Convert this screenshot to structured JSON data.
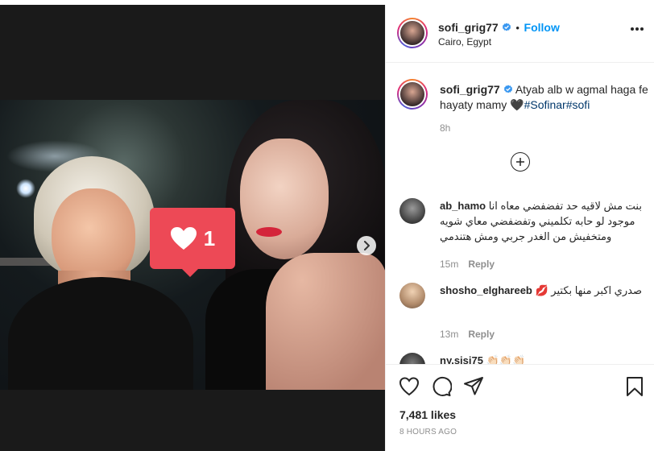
{
  "post": {
    "username": "sofi_grig77",
    "location": "Cairo, Egypt",
    "follow_label": "Follow",
    "dot": "•",
    "like_overlay_count": "1",
    "caption": {
      "username": "sofi_grig77",
      "text": "Atyab alb w agmal haga fe hayaty mamy",
      "heart": "🖤",
      "hashtags": [
        "#Sofinar",
        "#sofi"
      ],
      "time": "8h"
    },
    "comments": [
      {
        "username": "ab_hamo",
        "text": "بنت مش لاقيه حد تفضفضي معاه انا موجود لو حابه تكلميني وتفضفضي معاي شويه ومتخفيش من الغدر جربي ومش هتندمي",
        "time": "15m",
        "reply_label": "Reply"
      },
      {
        "username": "shosho_elghareeb",
        "text": "صدري اكبر منها بكتير 💋",
        "time": "13m",
        "reply_label": "Reply"
      },
      {
        "username": "ny.sisi75",
        "text": "👏🏻👏🏻👏🏻",
        "time": "",
        "reply_label": ""
      }
    ],
    "likes_text": "7,481 likes",
    "posted_ago": "8 HOURS AGO"
  },
  "colors": {
    "accent": "#0095f6",
    "like_red": "#ed4956",
    "hashtag": "#00376b",
    "muted": "#8e8e8e"
  },
  "icons": {
    "more": "more-options-icon",
    "verified": "verified-badge-icon",
    "like": "heart-icon",
    "comment": "comment-icon",
    "share": "share-icon",
    "save": "bookmark-icon",
    "load_more": "plus-circle-icon",
    "next": "chevron-right-icon"
  }
}
